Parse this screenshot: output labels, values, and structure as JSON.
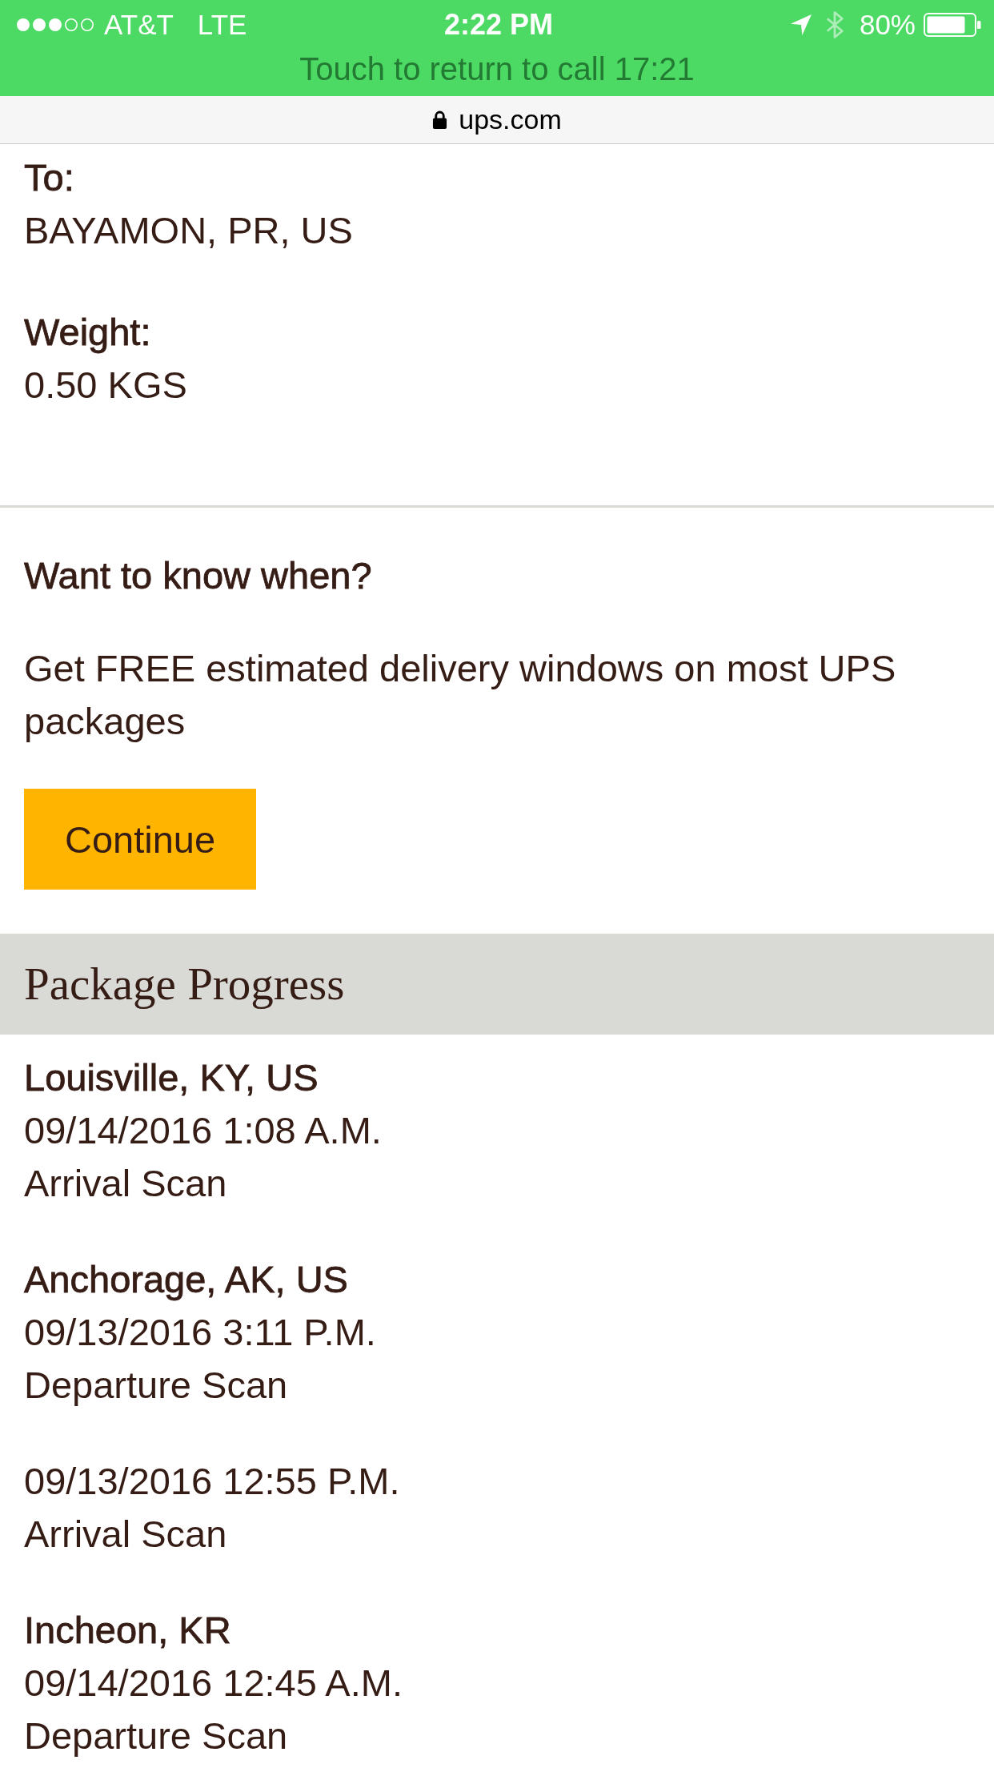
{
  "status_bar": {
    "carrier": "AT&T",
    "network": "LTE",
    "time": "2:22 PM",
    "battery": "80%"
  },
  "call_banner": {
    "text": "Touch to return to call 17:21"
  },
  "address_bar": {
    "url": "ups.com"
  },
  "shipment": [
    {
      "label": "To:",
      "value": "BAYAMON, PR, US"
    },
    {
      "label": "Weight:",
      "value": "0.50 KGS"
    }
  ],
  "promo": {
    "title": "Want to know when?",
    "text": "Get FREE estimated delivery windows on most UPS packages",
    "button": "Continue"
  },
  "progress": {
    "title": "Package Progress",
    "events": [
      {
        "location": "Louisville, KY, US",
        "datetime": "09/14/2016 1:08 A.M.",
        "activity": "Arrival Scan"
      },
      {
        "location": "Anchorage, AK, US",
        "datetime": "09/13/2016 3:11 P.M.",
        "activity": "Departure Scan"
      },
      {
        "datetime": "09/13/2016 12:55 P.M.",
        "activity": "Arrival Scan"
      },
      {
        "location": "Incheon, KR",
        "datetime": "09/14/2016 12:45 A.M.",
        "activity": "Departure Scan"
      }
    ]
  }
}
